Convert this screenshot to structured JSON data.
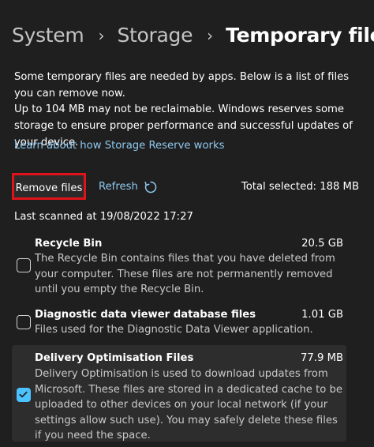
{
  "breadcrumb": {
    "items": [
      "System",
      "Storage",
      "Temporary files"
    ],
    "separator": "›"
  },
  "intro": {
    "text": "Some temporary files are needed by apps. Below is a list of files you can remove now."
  },
  "reserve_note": {
    "text": "Up to 104 MB may not be reclaimable. Windows reserves some storage to ensure proper performance and successful updates of your device."
  },
  "learn_link": {
    "label": "Learn about how Storage Reserve works"
  },
  "actions": {
    "remove_label": "Remove files",
    "refresh_label": "Refresh",
    "total_selected": "Total selected: 188 MB"
  },
  "last_scanned": "Last scanned at 19/08/2022 17:27",
  "items": [
    {
      "title": "Recycle Bin",
      "size": "20.5 GB",
      "description": "The Recycle Bin contains files that you have deleted from your computer. These files are not permanently removed until you empty the Recycle Bin.",
      "checked": false
    },
    {
      "title": "Diagnostic data viewer database files",
      "size": "1.01 GB",
      "description": "Files used for the Diagnostic Data Viewer application.",
      "checked": false
    },
    {
      "title": "Delivery Optimisation Files",
      "size": "77.9 MB",
      "description": "Delivery Optimisation is used to download updates from Microsoft. These files are stored in a dedicated cache to be uploaded to other devices on your local network (if your settings allow such use). You may safely delete these files if you need the space.",
      "checked": true
    }
  ],
  "colors": {
    "background": "#1f1f1f",
    "link": "#8fc9f0",
    "accent": "#4cc2ff",
    "highlight_border": "#e1131a",
    "selected_row": "#2d2d2d"
  },
  "icons": {
    "refresh": "refresh-icon",
    "checkmark": "checkmark-icon",
    "separator": "chevron-right-icon"
  }
}
